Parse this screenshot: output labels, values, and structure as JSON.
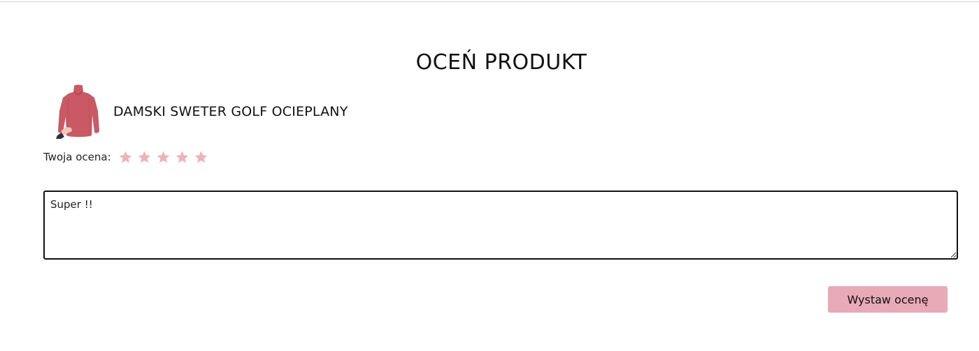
{
  "page": {
    "title": "OCEŃ PRODUKT"
  },
  "product": {
    "name": "DAMSKI SWETER GOLF OCIEPLANY",
    "image_icon": "pink-turtleneck-sweater-image"
  },
  "rating": {
    "label": "Twoja ocena:",
    "max_stars": 5,
    "selected_stars": 0,
    "star_icon": "star-icon",
    "star_color": "#efb3b7"
  },
  "review": {
    "value": "Super !!",
    "placeholder": ""
  },
  "submit": {
    "label": "Wystaw ocenę",
    "background": "#e9aab7"
  },
  "colors": {
    "accent": "#e9aab7",
    "sweater": "#c95964",
    "text": "#111111"
  }
}
